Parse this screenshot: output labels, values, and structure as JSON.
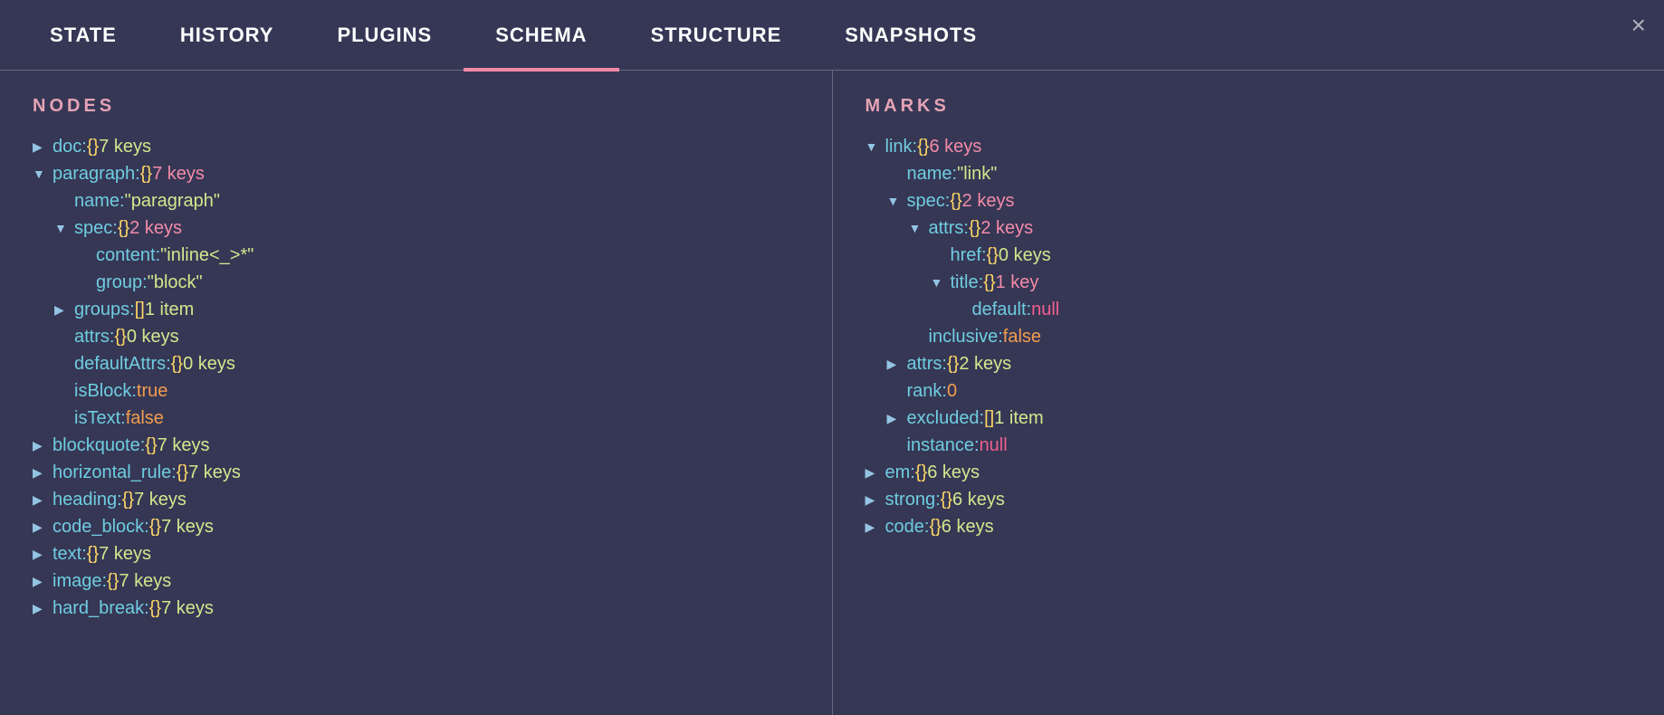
{
  "tabs": [
    {
      "label": "STATE",
      "active": false
    },
    {
      "label": "HISTORY",
      "active": false
    },
    {
      "label": "PLUGINS",
      "active": false
    },
    {
      "label": "SCHEMA",
      "active": true
    },
    {
      "label": "STRUCTURE",
      "active": false
    },
    {
      "label": "SNAPSHOTS",
      "active": false
    }
  ],
  "close_glyph": "×",
  "left": {
    "heading": "NODES",
    "rows": [
      {
        "indent": 0,
        "arrow": "right",
        "key": "doc:",
        "brackets": "{}",
        "summary": "7 keys",
        "summaryClass": "summary"
      },
      {
        "indent": 0,
        "arrow": "down",
        "key": "paragraph:",
        "brackets": "{}",
        "summary": "7 keys",
        "summaryClass": "pink"
      },
      {
        "indent": 1,
        "arrow": "",
        "key": "name:",
        "value": "\"paragraph\"",
        "valueClass": "str"
      },
      {
        "indent": 1,
        "arrow": "down",
        "key": "spec:",
        "brackets": "{}",
        "summary": "2 keys",
        "summaryClass": "pink"
      },
      {
        "indent": 2,
        "arrow": "",
        "key": "content:",
        "value": "\"inline<_>*\"",
        "valueClass": "str"
      },
      {
        "indent": 2,
        "arrow": "",
        "key": "group:",
        "value": "\"block\"",
        "valueClass": "str"
      },
      {
        "indent": 1,
        "arrow": "right",
        "key": "groups:",
        "brackets": "[]",
        "summary": "1 item",
        "summaryClass": "summary"
      },
      {
        "indent": 1,
        "arrow": "",
        "key": "attrs:",
        "brackets": "{}",
        "summary": "0 keys",
        "summaryClass": "summary"
      },
      {
        "indent": 1,
        "arrow": "",
        "key": "defaultAttrs:",
        "brackets": "{}",
        "summary": "0 keys",
        "summaryClass": "summary"
      },
      {
        "indent": 1,
        "arrow": "",
        "key": "isBlock:",
        "value": "true",
        "valueClass": "bool"
      },
      {
        "indent": 1,
        "arrow": "",
        "key": "isText:",
        "value": "false",
        "valueClass": "bool"
      },
      {
        "indent": 0,
        "arrow": "right",
        "key": "blockquote:",
        "brackets": "{}",
        "summary": "7 keys",
        "summaryClass": "summary"
      },
      {
        "indent": 0,
        "arrow": "right",
        "key": "horizontal_rule:",
        "brackets": "{}",
        "summary": "7 keys",
        "summaryClass": "summary"
      },
      {
        "indent": 0,
        "arrow": "right",
        "key": "heading:",
        "brackets": "{}",
        "summary": "7 keys",
        "summaryClass": "summary"
      },
      {
        "indent": 0,
        "arrow": "right",
        "key": "code_block:",
        "brackets": "{}",
        "summary": "7 keys",
        "summaryClass": "summary"
      },
      {
        "indent": 0,
        "arrow": "right",
        "key": "text:",
        "brackets": "{}",
        "summary": "7 keys",
        "summaryClass": "summary"
      },
      {
        "indent": 0,
        "arrow": "right",
        "key": "image:",
        "brackets": "{}",
        "summary": "7 keys",
        "summaryClass": "summary"
      },
      {
        "indent": 0,
        "arrow": "right",
        "key": "hard_break:",
        "brackets": "{}",
        "summary": "7 keys",
        "summaryClass": "summary"
      }
    ]
  },
  "right": {
    "heading": "MARKS",
    "rows": [
      {
        "indent": 0,
        "arrow": "down",
        "key": "link:",
        "brackets": "{}",
        "summary": "6 keys",
        "summaryClass": "pink"
      },
      {
        "indent": 1,
        "arrow": "",
        "key": "name:",
        "value": "\"link\"",
        "valueClass": "str"
      },
      {
        "indent": 1,
        "arrow": "down",
        "key": "spec:",
        "brackets": "{}",
        "summary": "2 keys",
        "summaryClass": "pink"
      },
      {
        "indent": 2,
        "arrow": "down",
        "key": "attrs:",
        "brackets": "{}",
        "summary": "2 keys",
        "summaryClass": "pink"
      },
      {
        "indent": 3,
        "arrow": "",
        "key": "href:",
        "brackets": "{}",
        "summary": "0 keys",
        "summaryClass": "summary"
      },
      {
        "indent": 3,
        "arrow": "down",
        "key": "title:",
        "brackets": "{}",
        "summary": "1 key",
        "summaryClass": "pink"
      },
      {
        "indent": 4,
        "arrow": "",
        "key": "default:",
        "value": "null",
        "valueClass": "nullv"
      },
      {
        "indent": 2,
        "arrow": "",
        "key": "inclusive:",
        "value": "false",
        "valueClass": "bool"
      },
      {
        "indent": 1,
        "arrow": "right",
        "key": "attrs:",
        "brackets": "{}",
        "summary": "2 keys",
        "summaryClass": "summary"
      },
      {
        "indent": 1,
        "arrow": "",
        "key": "rank:",
        "value": "0",
        "valueClass": "num"
      },
      {
        "indent": 1,
        "arrow": "right",
        "key": "excluded:",
        "brackets": "[]",
        "summary": "1 item",
        "summaryClass": "summary"
      },
      {
        "indent": 1,
        "arrow": "",
        "key": "instance:",
        "value": "null",
        "valueClass": "nullv"
      },
      {
        "indent": 0,
        "arrow": "right",
        "key": "em:",
        "brackets": "{}",
        "summary": "6 keys",
        "summaryClass": "summary"
      },
      {
        "indent": 0,
        "arrow": "right",
        "key": "strong:",
        "brackets": "{}",
        "summary": "6 keys",
        "summaryClass": "summary"
      },
      {
        "indent": 0,
        "arrow": "right",
        "key": "code:",
        "brackets": "{}",
        "summary": "6 keys",
        "summaryClass": "summary"
      }
    ]
  }
}
